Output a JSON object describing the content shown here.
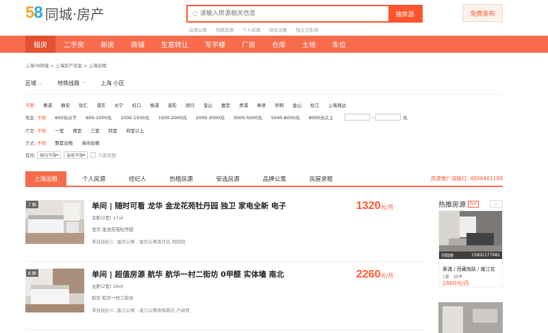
{
  "logo": {
    "digit5": "5",
    "digit8": "8",
    "brand": "同城·房产"
  },
  "search": {
    "placeholder": "请输入房源相关信息",
    "button": "搜房源",
    "hot_keywords": [
      "品牌公寓",
      "热租房源",
      "个人房源",
      "阳光注册",
      "独立卫生间"
    ]
  },
  "header": {
    "publish": "免费发布"
  },
  "nav": {
    "items": [
      "租房",
      "二手房",
      "新房",
      "商铺",
      "生意转让",
      "写字楼",
      "厂房",
      "仓库",
      "土地",
      "车位"
    ],
    "active_index": 0
  },
  "breadcrumb": "上海58同城 > 上海房产信息 > 上海出租",
  "area_tabs": [
    "区域",
    "地铁线路",
    "上海 小区"
  ],
  "filters": {
    "districts": [
      "不限",
      "黄浦",
      "静安",
      "徐汇",
      "浦东",
      "长宁",
      "虹口",
      "杨浦",
      "普陀",
      "闵行",
      "宝山",
      "嘉定",
      "青浦",
      "奉贤",
      "崇明",
      "金山",
      "松江",
      "上海周边"
    ],
    "rent_label": "租金:",
    "rents": [
      "不限",
      "600元以下",
      "600-1000元",
      "1000-1500元",
      "1500-2000元",
      "2000-3000元",
      "3000-5000元",
      "5000-8000元",
      "8000元以上"
    ],
    "rent_dash": "-",
    "rent_unit": "元",
    "room_label": "厅室:",
    "rooms": [
      "不限",
      "一室",
      "两室",
      "三室",
      "四室",
      "四室以上"
    ],
    "mode_label": "方式:",
    "modes": [
      "不限",
      "整套出租",
      "单间出租"
    ],
    "other_label": "其他:",
    "orientation": "朝向不限",
    "decoration": "装修不限",
    "has_image": "只看有图"
  },
  "tabs": {
    "items": [
      "上海出租",
      "个人房源",
      "经纪人",
      "热租房源",
      "安选房源",
      "品牌公寓",
      "房屋求租"
    ],
    "active_index": 0,
    "hotline": "房源推广请拨打: 4006401189"
  },
  "listings": [
    {
      "count": "7 图",
      "title": "单间 | 随时可看 龙华 金龙花苑牡丹园 独卫 家电全新 电子",
      "meta": "主卧(2室)        17㎡",
      "addr": "龙华    金龙花苑牡丹园",
      "agent": "来自经纪人: 蛋壳公寓 - 蛋壳公寓南丹店 周园园",
      "price": "1320",
      "unit": "元/月"
    },
    {
      "count": "8 图",
      "title": "单间 | 超值房源 航华 航华一村二街坊 0甲醛 实体墙 南北",
      "meta": "主卧(2室)        16㎡",
      "addr": "航华    航华一村二街坊",
      "agent": "来自经纪人: 蛋几公寓 - 蛋几公寓香梅路店 卢淑君",
      "price": "2260",
      "unit": "元/月"
    }
  ],
  "sidebar": {
    "title": "热推房源",
    "hot_badge": "hot",
    "card": {
      "agent_name": "刘晓丽",
      "agent_phone": "15802177981",
      "location": "黄浦 / 西藏南路 / 耀江花",
      "rooms": "1室",
      "area": "35平",
      "price": "2860元/月"
    }
  },
  "colors": {
    "brand": "#ff552e",
    "nav": "#f86c4d"
  }
}
